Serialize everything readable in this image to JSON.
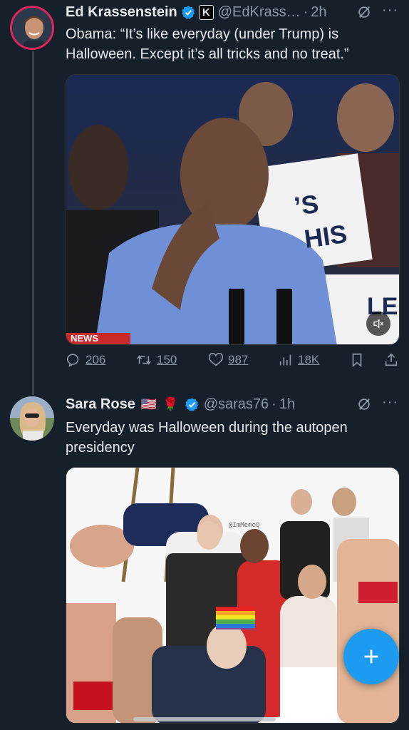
{
  "tweet1": {
    "name": "Ed Krassenstein",
    "k_badge": "K",
    "handle": "@EdKrass…",
    "dot": "·",
    "time": "2h",
    "more": "···",
    "text": "Obama: “It’s like everyday (under Trump) is Halloween. Except it’s all tricks and no treat.”",
    "video_sign_text_1": "’S",
    "video_sign_text_2": "HIS",
    "video_sign_text_3": "LE",
    "video_news_banner": "NEWS",
    "stats": {
      "replies": "206",
      "retweets": "150",
      "likes": "987",
      "views": "18K"
    }
  },
  "tweet2": {
    "name": "Sara Rose",
    "flag": "🇺🇸",
    "rose": "🌹",
    "handle": "@saras76",
    "dot": "·",
    "time": "1h",
    "more": "···",
    "text": "Everyday was Halloween during the autopen presidency",
    "image_watermark": "@ImMemeQ"
  },
  "colors": {
    "background": "#15202b",
    "verified": "#1d9bf0",
    "secondary_text": "#8b98a5",
    "fab": "#1d9bf0",
    "avatar_ring": "#e0245e"
  },
  "icons": [
    "verified-badge-icon",
    "grok-icon",
    "more-icon",
    "reply-icon",
    "retweet-icon",
    "like-icon",
    "views-icon",
    "bookmark-icon",
    "share-icon",
    "mute-icon",
    "compose-plus-icon"
  ]
}
